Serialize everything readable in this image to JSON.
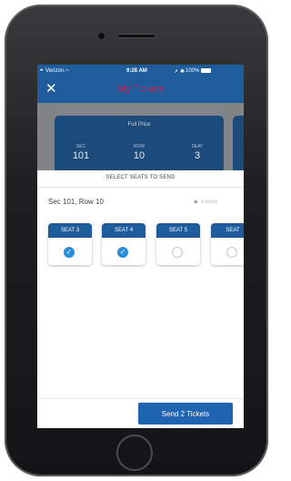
{
  "status_bar": {
    "carrier": "Verizon",
    "time": "9:28 AM",
    "battery": "100%"
  },
  "header": {
    "title": "My Tickets",
    "close_icon": "close-icon"
  },
  "ticket": {
    "price_type": "Full Price",
    "sec_label": "SEC",
    "sec_value": "101",
    "row_label": "ROW",
    "row_value": "10",
    "seat_label": "SEAT",
    "seat_value": "3"
  },
  "sheet": {
    "title": "SELECT SEATS TO SEND",
    "section_label": "Sec 101, Row 10",
    "ticket_count": "4 tickets",
    "seats": [
      {
        "label": "SEAT 3",
        "selected": true
      },
      {
        "label": "SEAT 4",
        "selected": true
      },
      {
        "label": "SEAT 5",
        "selected": false
      },
      {
        "label": "SEAT",
        "selected": false
      }
    ],
    "send_label": "Send 2 Tickets"
  },
  "colors": {
    "brand_blue": "#1f5c9c",
    "title_red": "#c8224b",
    "check_blue": "#2a8fd8"
  }
}
